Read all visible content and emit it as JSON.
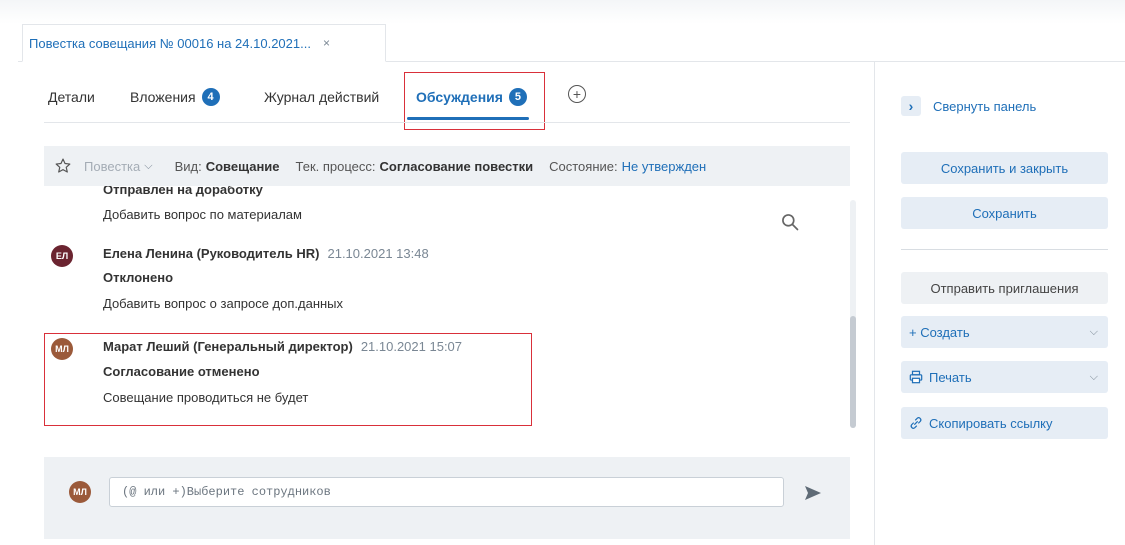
{
  "doc_tab": {
    "title": "Повестка совещания № 00016 на 24.10.2021...",
    "close": "×"
  },
  "tabs": [
    {
      "label": "Детали"
    },
    {
      "label": "Вложения",
      "badge": "4"
    },
    {
      "label": "Журнал действий"
    },
    {
      "label": "Обсуждения",
      "badge": "5",
      "active": true
    }
  ],
  "add_tab_symbol": "+",
  "infobar": {
    "agenda": "Повестка",
    "kind_label": "Вид:",
    "kind_value": "Совещание",
    "process_label": "Тек. процесс:",
    "process_value": "Согласование повестки",
    "state_label": "Состояние:",
    "state_value": "Не утвержден"
  },
  "discussion": {
    "cut_status": "Отправлен на доработку",
    "first_text": "Добавить вопрос по материалам",
    "messages": [
      {
        "initials": "ЕЛ",
        "author": "Елена Ленина (Руководитель HR)",
        "time": "21.10.2021 13:48",
        "status": "Отклонено",
        "text": "Добавить вопрос о запросе доп.данных"
      },
      {
        "initials": "МЛ",
        "author": "Марат Леший (Генеральный директор)",
        "time": "21.10.2021 15:07",
        "status": "Согласование отменено",
        "text": "Совещание проводиться не будет"
      }
    ]
  },
  "compose": {
    "initials": "МЛ",
    "placeholder": "(@ или +)Выберите сотрудников"
  },
  "sidebar": {
    "collapse_label": "Свернуть панель",
    "save_close": "Сохранить и закрыть",
    "save": "Сохранить",
    "send_invites": "Отправить приглашения",
    "create": "+ Создать",
    "print": "Печать",
    "copy_link": "Скопировать ссылку"
  },
  "colors": {
    "accent": "#1f6fb8",
    "highlight": "#d9303a",
    "panel": "#eef1f4",
    "button_bg": "#e6edf5"
  }
}
